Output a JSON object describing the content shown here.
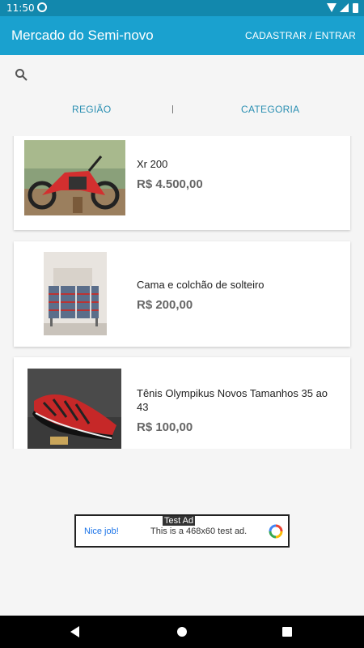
{
  "status_bar": {
    "time": "11:50",
    "icons": [
      "sync-icon",
      "wifi-icon",
      "signal-icon",
      "battery-icon"
    ]
  },
  "app_bar": {
    "title": "Mercado do Semi-novo",
    "action_label": "CADASTRAR / ENTRAR",
    "color": "#1aa1cf"
  },
  "search": {
    "icon": "search-icon"
  },
  "filters": {
    "regiao_label": "REGIÃO",
    "categoria_label": "CATEGORIA",
    "accent": "#2a8fb2"
  },
  "listings": [
    {
      "title": "Xr 200",
      "price": "R$ 4.500,00",
      "image": "motorcycle"
    },
    {
      "title": "Cama e colchão de solteiro",
      "price": "R$ 200,00",
      "image": "bed"
    },
    {
      "title": "Tênis Olympikus Novos Tamanhos 35 ao 43",
      "price": "R$ 100,00",
      "image": "sneaker"
    }
  ],
  "ad": {
    "label": "Test Ad",
    "nice": "Nice job!",
    "text": "This is a 468x60 test ad."
  },
  "nav": {
    "icons": [
      "back-icon",
      "home-icon",
      "recents-icon"
    ]
  }
}
